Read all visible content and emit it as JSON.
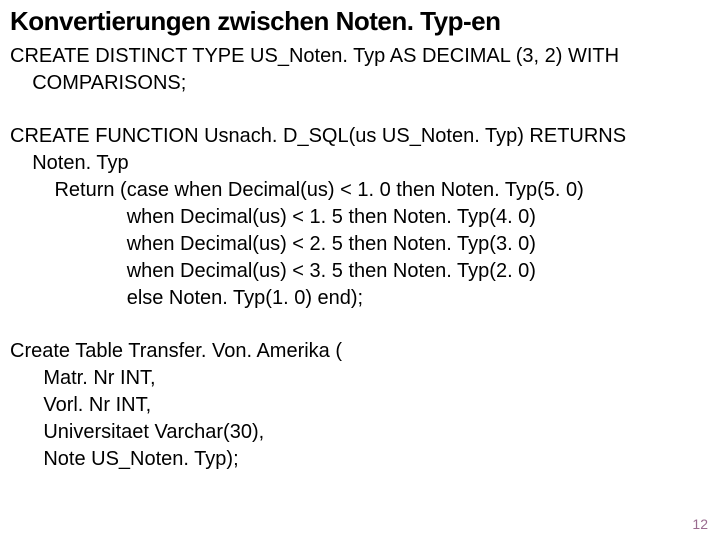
{
  "title": "Konvertierungen zwischen Noten. Typ-en",
  "code1": "CREATE DISTINCT TYPE US_Noten. Typ AS DECIMAL (3, 2) WITH\n    COMPARISONS;",
  "code2": "CREATE FUNCTION Usnach. D_SQL(us US_Noten. Typ) RETURNS\n    Noten. Typ\n        Return (case when Decimal(us) < 1. 0 then Noten. Typ(5. 0)\n                     when Decimal(us) < 1. 5 then Noten. Typ(4. 0)\n                     when Decimal(us) < 2. 5 then Noten. Typ(3. 0)\n                     when Decimal(us) < 3. 5 then Noten. Typ(2. 0)\n                     else Noten. Typ(1. 0) end);",
  "code3": "Create Table Transfer. Von. Amerika (\n      Matr. Nr INT,\n      Vorl. Nr INT,\n      Universitaet Varchar(30),\n      Note US_Noten. Typ);",
  "page_number": "12"
}
